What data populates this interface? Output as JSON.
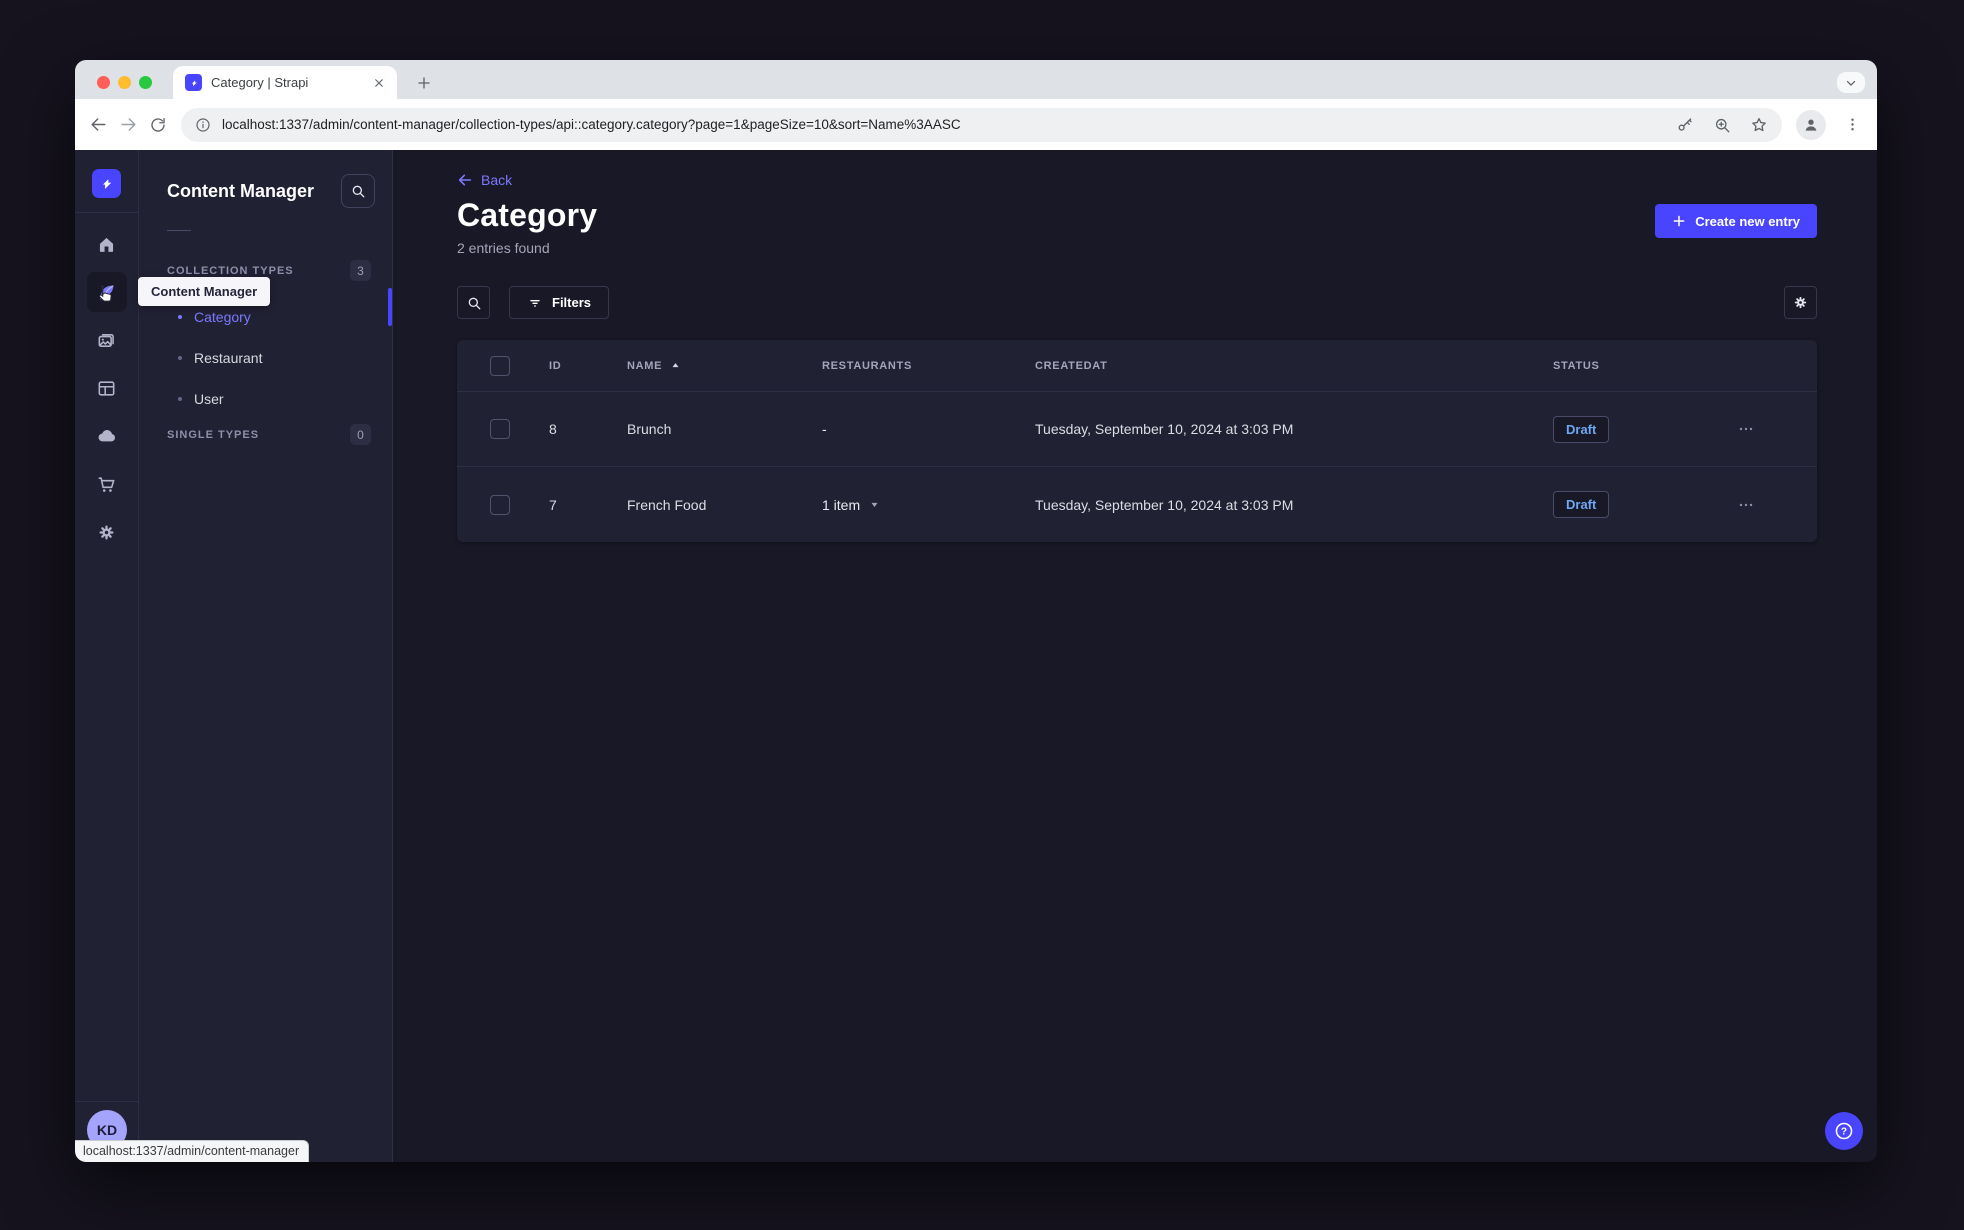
{
  "browser": {
    "tab_title": "Category | Strapi",
    "url": "localhost:1337/admin/content-manager/collection-types/api::category.category?page=1&pageSize=10&sort=Name%3AASC"
  },
  "nav": {
    "items": [
      {
        "name": "home",
        "active": false
      },
      {
        "name": "content-manager",
        "active": true
      },
      {
        "name": "media-library",
        "active": false
      },
      {
        "name": "content-type-builder",
        "active": false
      },
      {
        "name": "deploy-cloud",
        "active": false
      },
      {
        "name": "marketplace",
        "active": false
      },
      {
        "name": "settings",
        "active": false
      }
    ]
  },
  "subnav": {
    "title": "Content Manager",
    "sections": [
      {
        "label": "COLLECTION TYPES",
        "badge": "3",
        "items": [
          {
            "label": "Category",
            "active": true
          },
          {
            "label": "Restaurant",
            "active": false
          },
          {
            "label": "User",
            "active": false
          }
        ]
      },
      {
        "label": "SINGLE TYPES",
        "badge": "0",
        "items": []
      }
    ]
  },
  "tooltip": {
    "text": "Content Manager"
  },
  "header": {
    "back_label": "Back",
    "title": "Category",
    "subtitle": "2 entries found",
    "create_button_label": "Create new entry"
  },
  "actions": {
    "filters_label": "Filters"
  },
  "table": {
    "columns": [
      "ID",
      "NAME",
      "RESTAURANTS",
      "CREATEDAT",
      "STATUS"
    ],
    "sorted_column": "NAME",
    "sort_direction": "ASC",
    "rows": [
      {
        "id": "8",
        "name": "Brunch",
        "restaurants": "-",
        "restaurants_caret": false,
        "createdAt": "Tuesday, September 10, 2024 at 3:03 PM",
        "status": "Draft"
      },
      {
        "id": "7",
        "name": "French Food",
        "restaurants": "1 item",
        "restaurants_caret": true,
        "createdAt": "Tuesday, September 10, 2024 at 3:03 PM",
        "status": "Draft"
      }
    ]
  },
  "avatar": {
    "initials": "KD"
  },
  "statusbar": {
    "text": "localhost:1337/admin/content-manager"
  },
  "colors": {
    "accent": "#4945ff",
    "link": "#7b79ff",
    "draft_text": "#6fa8f5",
    "page_bg": "#181826",
    "panel_bg": "#212134",
    "traffic_close": "#ff5f57",
    "traffic_minimize": "#febc2e",
    "traffic_maximize": "#28c840"
  }
}
